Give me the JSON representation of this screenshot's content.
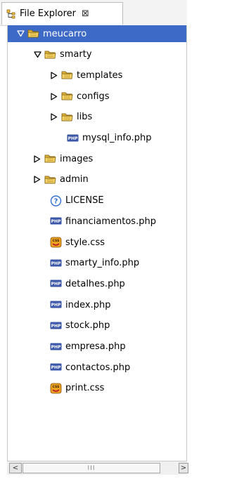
{
  "view": {
    "tab_title": "File Explorer",
    "tab_icon": "file-explorer-icon",
    "close_glyph": "⊠"
  },
  "colors": {
    "selection": "#3d6ac6",
    "folder": "#e8b83d",
    "php_icon": "#3a56a8",
    "css_icon": "#e9a21f",
    "help_icon": "#2f6fd1"
  },
  "tree": [
    {
      "label": "meucarro",
      "type": "folder",
      "depth": 0,
      "expanded": true,
      "selected": true
    },
    {
      "label": "smarty",
      "type": "folder",
      "depth": 1,
      "expanded": true
    },
    {
      "label": "templates",
      "type": "folder",
      "depth": 2,
      "expanded": false
    },
    {
      "label": "configs",
      "type": "folder",
      "depth": 2,
      "expanded": false
    },
    {
      "label": "libs",
      "type": "folder",
      "depth": 2,
      "expanded": false
    },
    {
      "label": "mysql_info.php",
      "type": "php",
      "depth": 3
    },
    {
      "label": "images",
      "type": "folder",
      "depth": 1,
      "expanded": false
    },
    {
      "label": "admin",
      "type": "folder",
      "depth": 1,
      "expanded": false
    },
    {
      "label": "LICENSE",
      "type": "help",
      "depth": 2
    },
    {
      "label": "financiamentos.php",
      "type": "php",
      "depth": 2
    },
    {
      "label": "style.css",
      "type": "css",
      "depth": 2
    },
    {
      "label": "smarty_info.php",
      "type": "php",
      "depth": 2
    },
    {
      "label": "detalhes.php",
      "type": "php",
      "depth": 2
    },
    {
      "label": "index.php",
      "type": "php",
      "depth": 2
    },
    {
      "label": "stock.php",
      "type": "php",
      "depth": 2
    },
    {
      "label": "empresa.php",
      "type": "php",
      "depth": 2
    },
    {
      "label": "contactos.php",
      "type": "php",
      "depth": 2
    },
    {
      "label": "print.css",
      "type": "css",
      "depth": 2
    }
  ],
  "scrollbar": {
    "left_arrow": "<",
    "right_arrow": ">",
    "grip": "III"
  }
}
